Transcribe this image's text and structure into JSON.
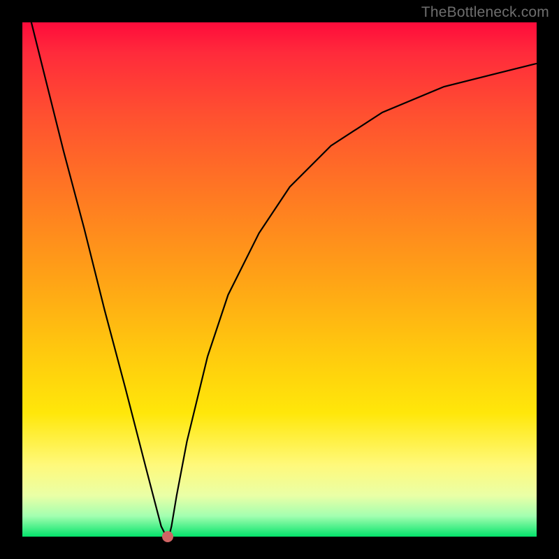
{
  "watermark": "TheBottleneck.com",
  "chart_data": {
    "type": "line",
    "title": "",
    "xlabel": "",
    "ylabel": "",
    "xlim": [
      0,
      100
    ],
    "ylim": [
      0,
      100
    ],
    "grid": false,
    "legend": false,
    "series": [
      {
        "name": "bottleneck-curve",
        "x": [
          0,
          4,
          8,
          12,
          16,
          20,
          24,
          27,
          28,
          28.5,
          29,
          30,
          32,
          36,
          40,
          46,
          52,
          60,
          70,
          82,
          92,
          100
        ],
        "y": [
          107,
          91,
          75,
          60,
          44,
          29,
          13.5,
          2,
          0,
          0,
          2,
          8,
          18.5,
          35,
          47,
          59,
          68,
          76,
          82.5,
          87.5,
          90,
          92
        ]
      }
    ],
    "markers": [
      {
        "name": "optimum-point",
        "x": 28.3,
        "y": 0
      }
    ],
    "background_gradient": {
      "top": "#ff0b3b",
      "bottom": "#04e36b"
    }
  }
}
